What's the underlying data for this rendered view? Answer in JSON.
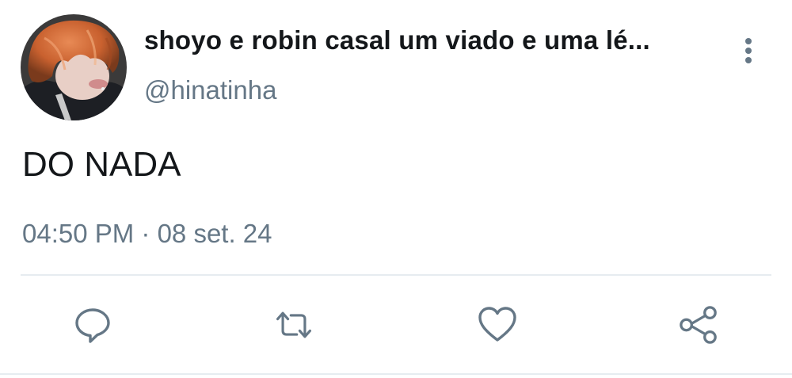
{
  "tweet": {
    "author": {
      "display_name": "shoyo e robin casal um viado e uma lé...",
      "handle": "@hinatinha",
      "avatar_icon": "user-avatar"
    },
    "text": "DO NADA",
    "timestamp": "04:50 PM · 08 set. 24",
    "more_icon": "vertical-dots-icon"
  },
  "actions": [
    {
      "name": "reply",
      "icon": "speech-bubble-icon"
    },
    {
      "name": "retweet",
      "icon": "retweet-arrows-icon"
    },
    {
      "name": "like",
      "icon": "heart-icon"
    },
    {
      "name": "share",
      "icon": "share-nodes-icon"
    }
  ],
  "colors": {
    "text": "#14171a",
    "secondary": "#657786",
    "icon": "#657786",
    "divider": "#e6ecf0",
    "background": "#ffffff"
  }
}
